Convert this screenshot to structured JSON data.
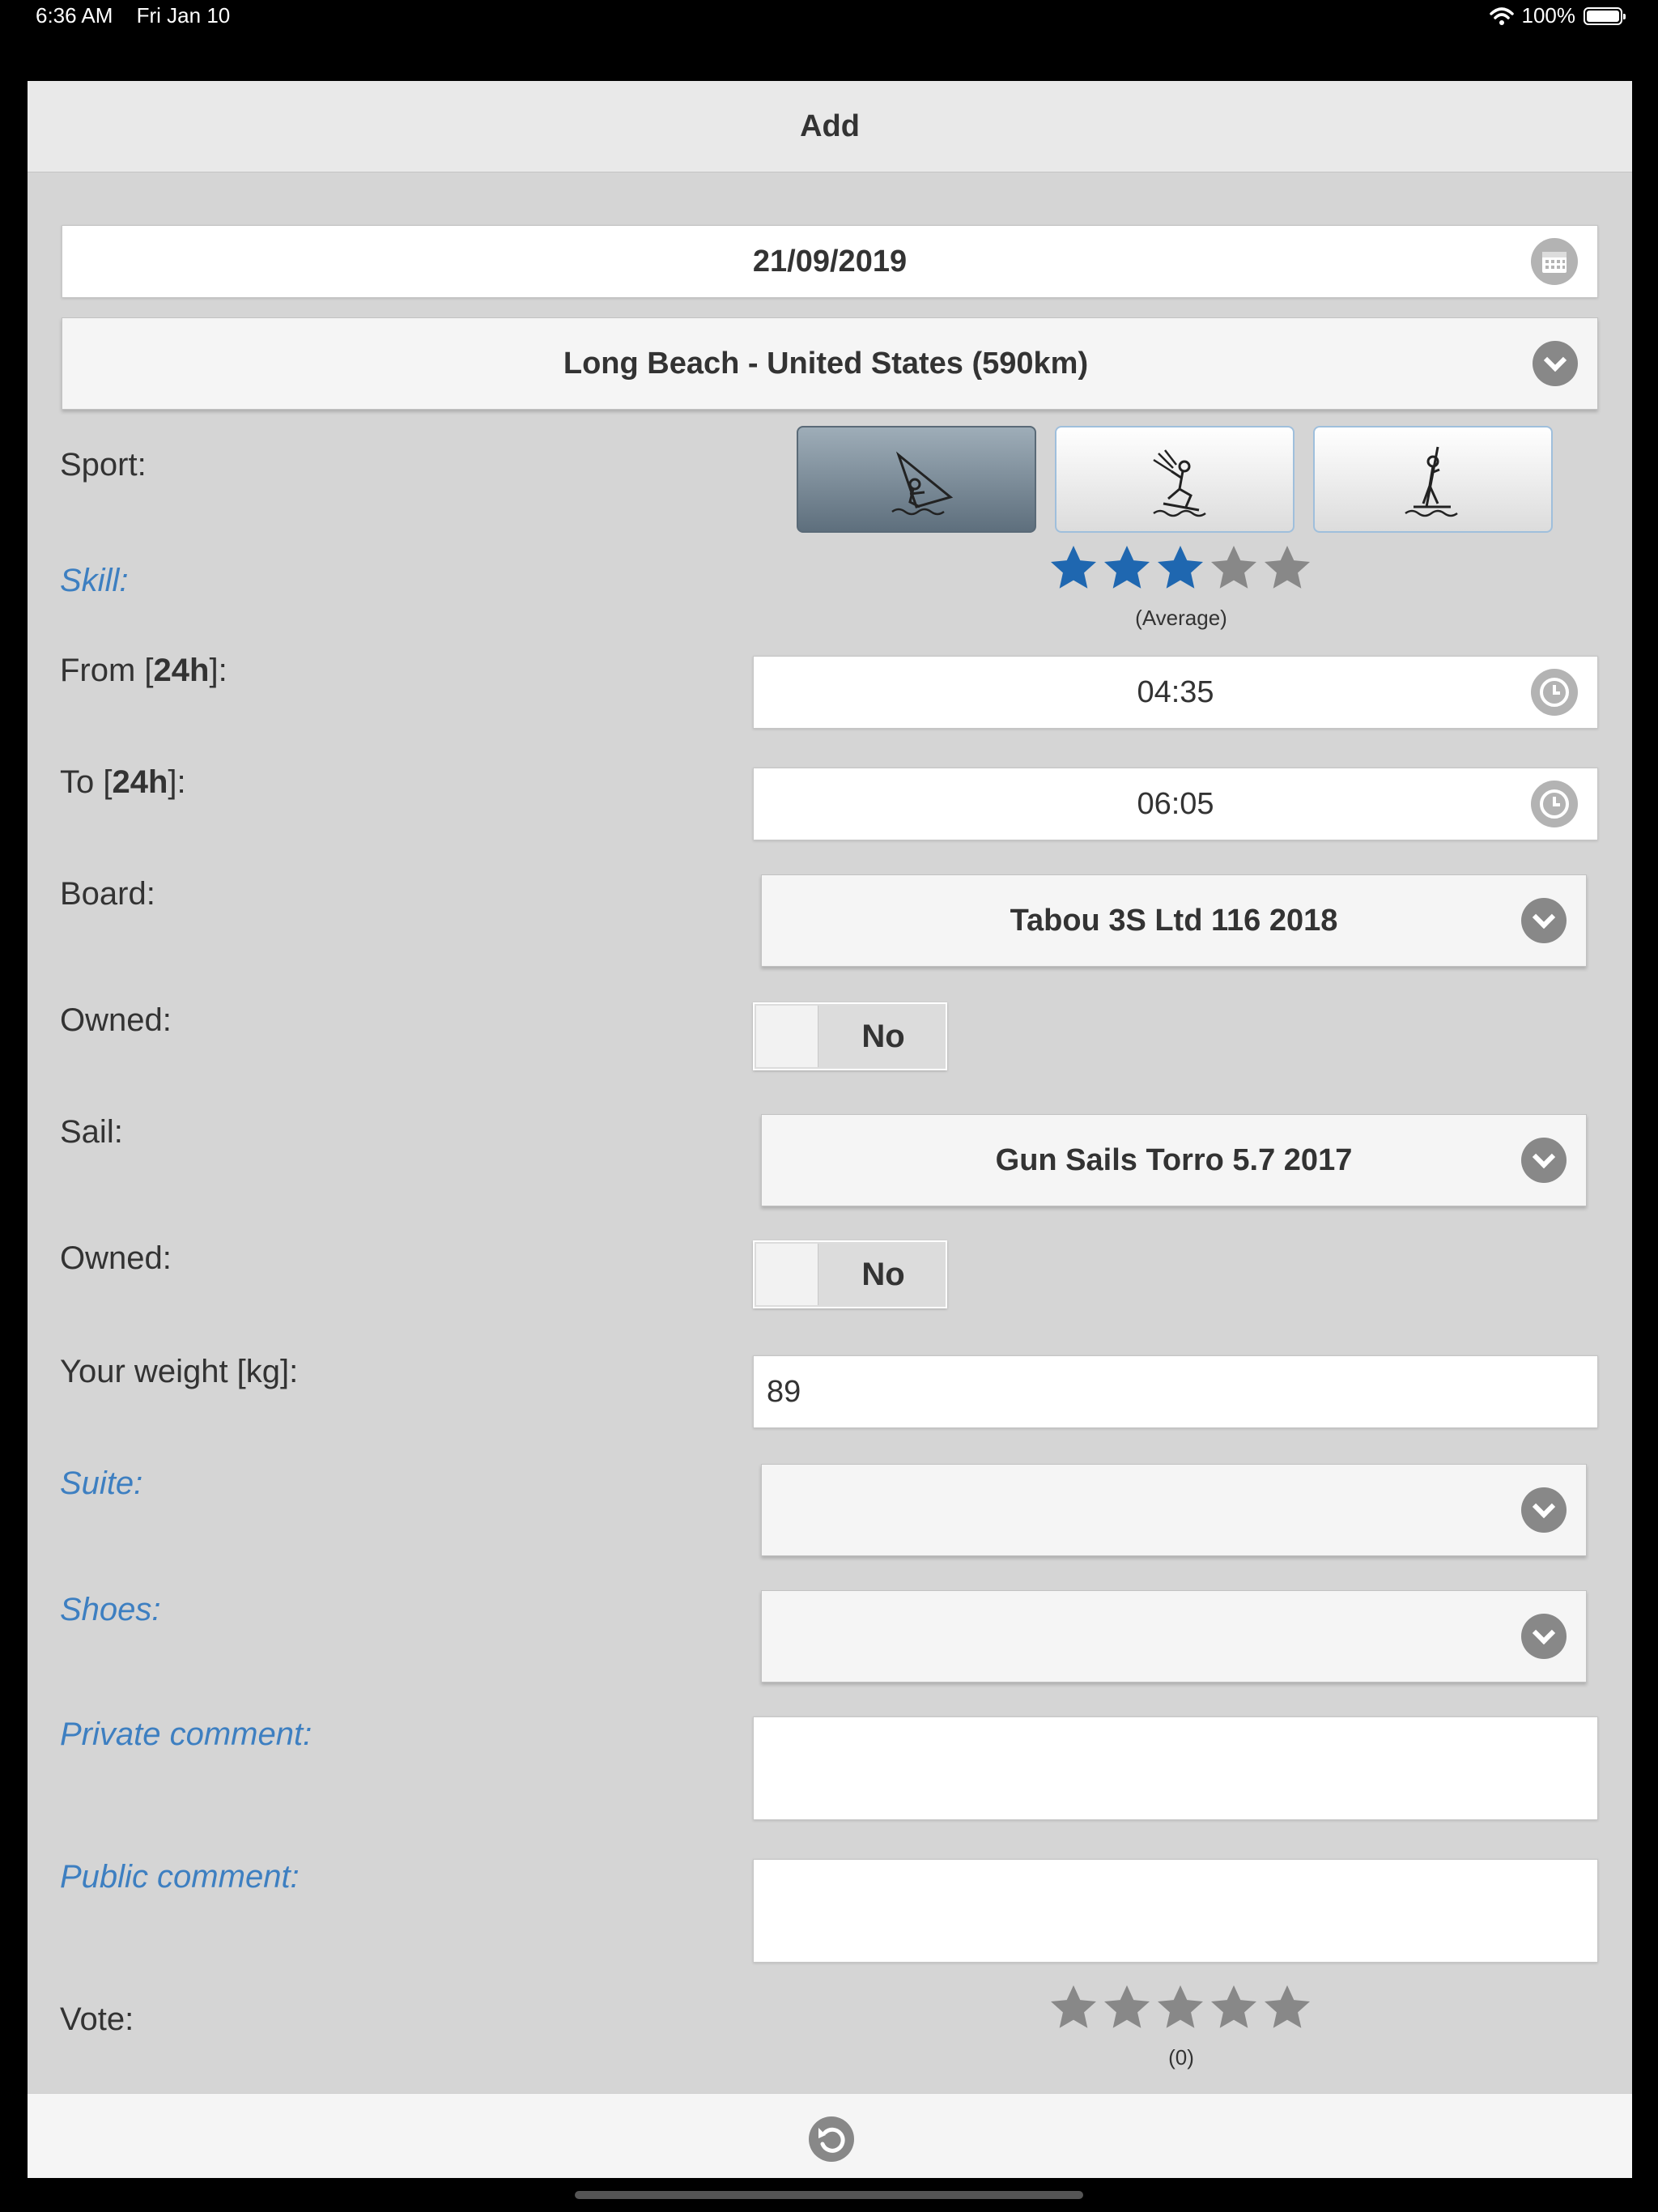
{
  "status_bar": {
    "time": "6:36 AM",
    "date": "Fri Jan 10",
    "battery": "100%"
  },
  "header": {
    "title": "Add"
  },
  "date_field": {
    "value": "21/09/2019",
    "icon": "calendar-icon"
  },
  "spot_select": {
    "value": "Long Beach - United States (590km)"
  },
  "sport": {
    "label": "Sport:",
    "options": [
      "windsurf",
      "kitesurf",
      "stand-up paddle"
    ],
    "selected": "windsurf"
  },
  "skill": {
    "label": "Skill:",
    "rating": 3,
    "max": 5,
    "caption": "(Average)",
    "color_on": "#1f67b0",
    "color_off": "#888888"
  },
  "from": {
    "label_pre": "From [",
    "label_bold": "24h",
    "label_post": "]:",
    "value": "04:35"
  },
  "to": {
    "label_pre": "To [",
    "label_bold": "24h",
    "label_post": "]:",
    "value": "06:05"
  },
  "board": {
    "label": "Board:",
    "value": "Tabou 3S Ltd 116 2018",
    "owned_label": "Owned:",
    "owned_value": "No"
  },
  "sail": {
    "label": "Sail:",
    "value": "Gun Sails Torro 5.7 2017",
    "owned_label": "Owned:",
    "owned_value": "No"
  },
  "weight": {
    "label": "Your weight [kg]:",
    "value": "89"
  },
  "suite": {
    "label": "Suite:",
    "value": ""
  },
  "shoes": {
    "label": "Shoes:",
    "value": ""
  },
  "private_comment": {
    "label": "Private comment:",
    "value": ""
  },
  "public_comment": {
    "label": "Public comment:",
    "value": ""
  },
  "vote": {
    "label": "Vote:",
    "rating": 0,
    "max": 5,
    "caption": "(0)"
  },
  "footer": {
    "icon": "undo-icon"
  },
  "colors": {
    "optional_label": "#3d7fc1",
    "background": "#d5d5d5",
    "icon_gray": "#888888"
  }
}
